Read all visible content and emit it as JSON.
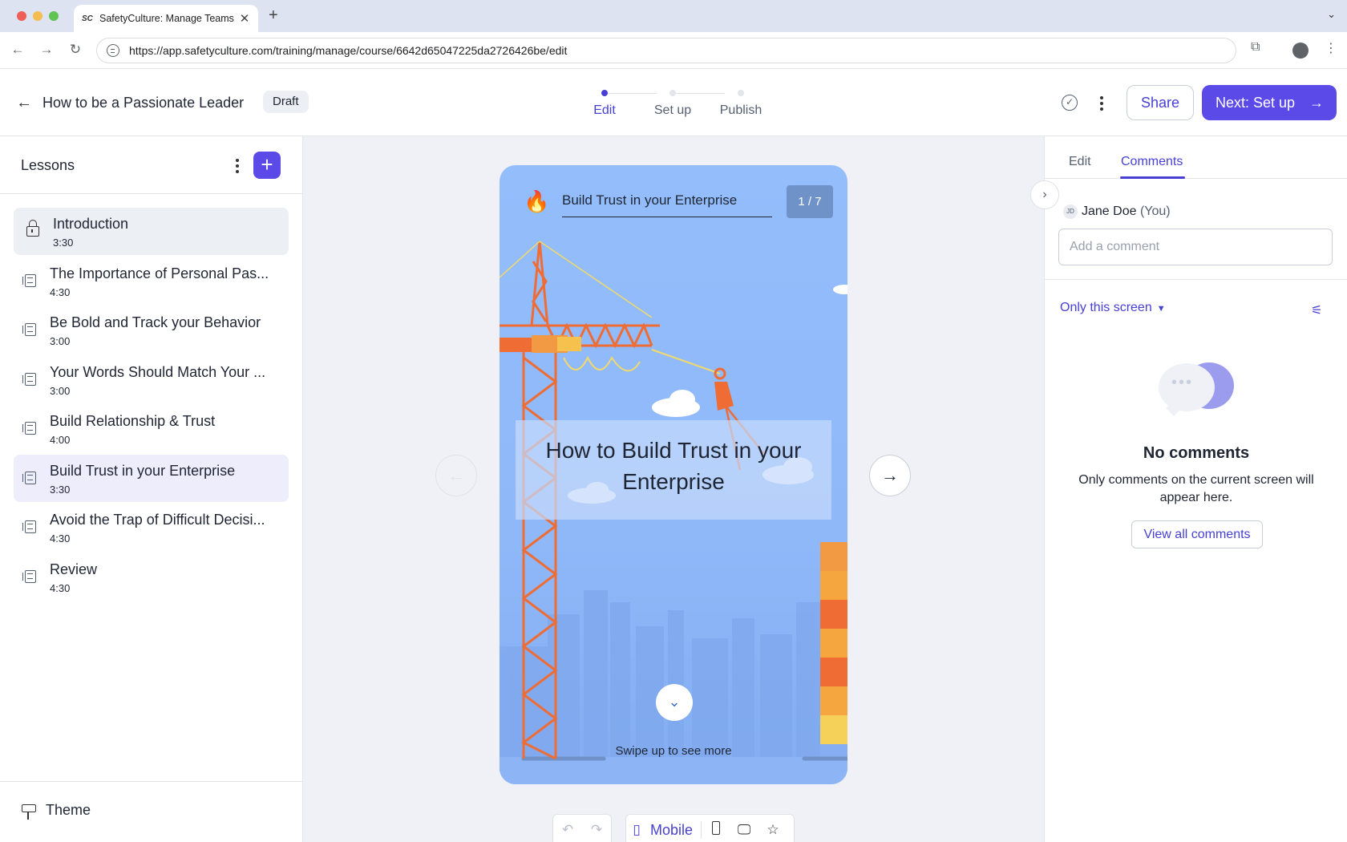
{
  "browser": {
    "tab_title": "SafetyCulture: Manage Teams",
    "favicon_text": "SC",
    "new_tab": "+",
    "url": "https://app.safetyculture.com/training/manage/course/6642d65047225da2726426be/edit"
  },
  "header": {
    "course_title": "How to be a Passionate Leader",
    "status_badge": "Draft",
    "steps": [
      {
        "label": "Edit",
        "active": true
      },
      {
        "label": "Set up",
        "active": false
      },
      {
        "label": "Publish",
        "active": false
      }
    ],
    "share_label": "Share",
    "next_label": "Next: Set up"
  },
  "sidebar": {
    "title": "Lessons",
    "lessons": [
      {
        "title": "Introduction",
        "duration": "3:30",
        "locked": true
      },
      {
        "title": "The Importance of Personal Pas...",
        "duration": "4:30"
      },
      {
        "title": "Be Bold and Track your Behavior",
        "duration": "3:00"
      },
      {
        "title": "Your Words Should Match Your ...",
        "duration": "3:00"
      },
      {
        "title": "Build Relationship & Trust",
        "duration": "4:00"
      },
      {
        "title": "Build Trust in your Enterprise",
        "duration": "3:30",
        "selected": true
      },
      {
        "title": "Avoid the Trap of Difficult Decisi...",
        "duration": "4:30"
      },
      {
        "title": "Review",
        "duration": "4:30"
      }
    ],
    "footer_label": "Theme"
  },
  "preview": {
    "screen_title": "Build Trust in your Enterprise",
    "counter": "1 / 7",
    "hero_text": "How to Build Trust in your Enterprise",
    "swipe_text": "Swipe up to see more",
    "device_label": "Mobile"
  },
  "comments_panel": {
    "tabs": [
      {
        "label": "Edit",
        "active": false
      },
      {
        "label": "Comments",
        "active": true
      }
    ],
    "avatar_initials": "JD",
    "user_name": "Jane Doe",
    "user_suffix": "(You)",
    "input_placeholder": "Add a comment",
    "filter_label": "Only this screen",
    "empty_title": "No comments",
    "empty_desc": "Only comments on the current screen will appear here.",
    "view_all_label": "View all comments"
  },
  "colors": {
    "brand": "#5b4ae8",
    "brand_text": "#4740d4",
    "phone_bg": "#93bdfb",
    "crane": "#ef6c35"
  }
}
